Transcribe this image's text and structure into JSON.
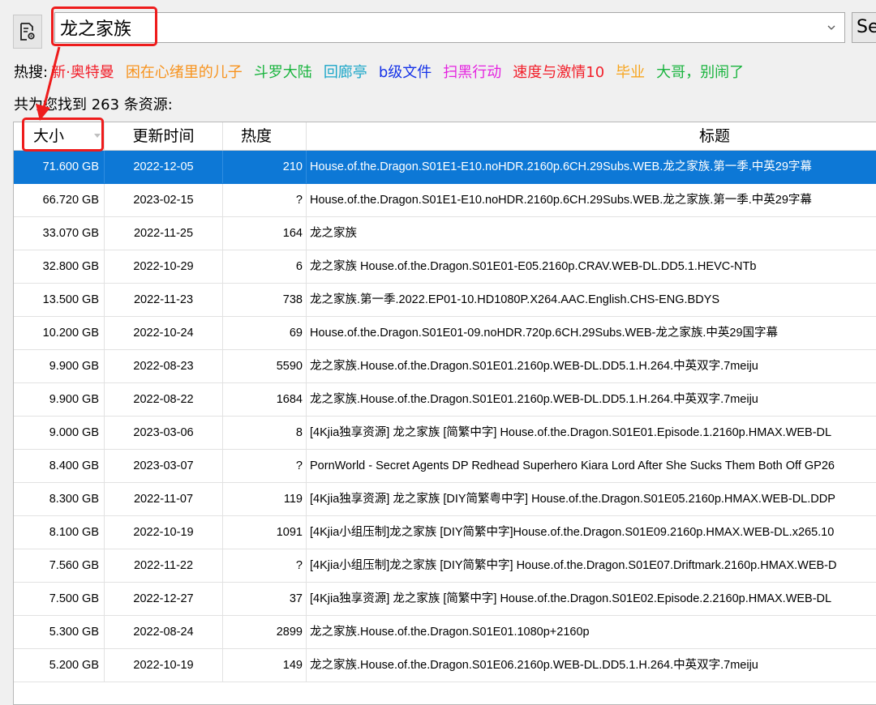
{
  "search": {
    "query": "龙之家族",
    "button_label": "Se"
  },
  "hot": {
    "label": "热搜:",
    "items": [
      {
        "text": "新·奥特曼",
        "color": "#f2202b"
      },
      {
        "text": "困在心绪里的儿子",
        "color": "#f7931e"
      },
      {
        "text": "斗罗大陆",
        "color": "#19b43e"
      },
      {
        "text": "回廊亭",
        "color": "#1aa6c8"
      },
      {
        "text": "b级文件",
        "color": "#1633e8"
      },
      {
        "text": "扫黑行动",
        "color": "#e522e0"
      },
      {
        "text": "速度与激情10",
        "color": "#f2202b"
      },
      {
        "text": "毕业",
        "color": "#f7a51e"
      },
      {
        "text": "大哥，别闹了",
        "color": "#19b43e"
      }
    ]
  },
  "result_count_text": "共为您找到 263 条资源:",
  "columns": {
    "size": "大小",
    "date": "更新时间",
    "heat": "热度",
    "title": "标题"
  },
  "rows": [
    {
      "size": "71.600 GB",
      "date": "2022-12-05",
      "heat": "210",
      "title": "House.of.the.Dragon.S01E1-E10.noHDR.2160p.6CH.29Subs.WEB.龙之家族.第一季.中英29字幕",
      "selected": true
    },
    {
      "size": "66.720 GB",
      "date": "2023-02-15",
      "heat": "?",
      "title": "House.of.the.Dragon.S01E1-E10.noHDR.2160p.6CH.29Subs.WEB.龙之家族.第一季.中英29字幕"
    },
    {
      "size": "33.070 GB",
      "date": "2022-11-25",
      "heat": "164",
      "title": "龙之家族"
    },
    {
      "size": "32.800 GB",
      "date": "2022-10-29",
      "heat": "6",
      "title": "龙之家族 House.of.the.Dragon.S01E01-E05.2160p.CRAV.WEB-DL.DD5.1.HEVC-NTb"
    },
    {
      "size": "13.500 GB",
      "date": "2022-11-23",
      "heat": "738",
      "title": "龙之家族.第一季.2022.EP01-10.HD1080P.X264.AAC.English.CHS-ENG.BDYS"
    },
    {
      "size": "10.200 GB",
      "date": "2022-10-24",
      "heat": "69",
      "title": "House.of.the.Dragon.S01E01-09.noHDR.720p.6CH.29Subs.WEB-龙之家族.中英29国字幕"
    },
    {
      "size": "9.900 GB",
      "date": "2022-08-23",
      "heat": "5590",
      "title": "龙之家族.House.of.the.Dragon.S01E01.2160p.WEB-DL.DD5.1.H.264.中英双字.7meiju"
    },
    {
      "size": "9.900 GB",
      "date": "2022-08-22",
      "heat": "1684",
      "title": "龙之家族.House.of.the.Dragon.S01E01.2160p.WEB-DL.DD5.1.H.264.中英双字.7meiju"
    },
    {
      "size": "9.000 GB",
      "date": "2023-03-06",
      "heat": "8",
      "title": "[4Kjia独享资源] 龙之家族 [简繁中字] House.of.the.Dragon.S01E01.Episode.1.2160p.HMAX.WEB-DL"
    },
    {
      "size": "8.400 GB",
      "date": "2023-03-07",
      "heat": "?",
      "title": "PornWorld - Secret Agents DP Redhead Superhero Kiara Lord After She Sucks Them Both Off GP26"
    },
    {
      "size": "8.300 GB",
      "date": "2022-11-07",
      "heat": "119",
      "title": "[4Kjia独享资源] 龙之家族 [DIY简繁粤中字] House.of.the.Dragon.S01E05.2160p.HMAX.WEB-DL.DDP"
    },
    {
      "size": "8.100 GB",
      "date": "2022-10-19",
      "heat": "1091",
      "title": "[4Kjia小组压制]龙之家族 [DIY简繁中字]House.of.the.Dragon.S01E09.2160p.HMAX.WEB-DL.x265.10"
    },
    {
      "size": "7.560 GB",
      "date": "2022-11-22",
      "heat": "?",
      "title": "[4Kjia小组压制]龙之家族 [DIY简繁中字] House.of.the.Dragon.S01E07.Driftmark.2160p.HMAX.WEB-D"
    },
    {
      "size": "7.500 GB",
      "date": "2022-12-27",
      "heat": "37",
      "title": "[4Kjia独享资源] 龙之家族 [简繁中字] House.of.the.Dragon.S01E02.Episode.2.2160p.HMAX.WEB-DL"
    },
    {
      "size": "5.300 GB",
      "date": "2022-08-24",
      "heat": "2899",
      "title": "龙之家族.House.of.the.Dragon.S01E01.1080p+2160p"
    },
    {
      "size": "5.200 GB",
      "date": "2022-10-19",
      "heat": "149",
      "title": "龙之家族.House.of.the.Dragon.S01E06.2160p.WEB-DL.DD5.1.H.264.中英双字.7meiju"
    }
  ],
  "colors": {
    "selection": "#0d78d6",
    "annotation": "#ee1c1c"
  }
}
